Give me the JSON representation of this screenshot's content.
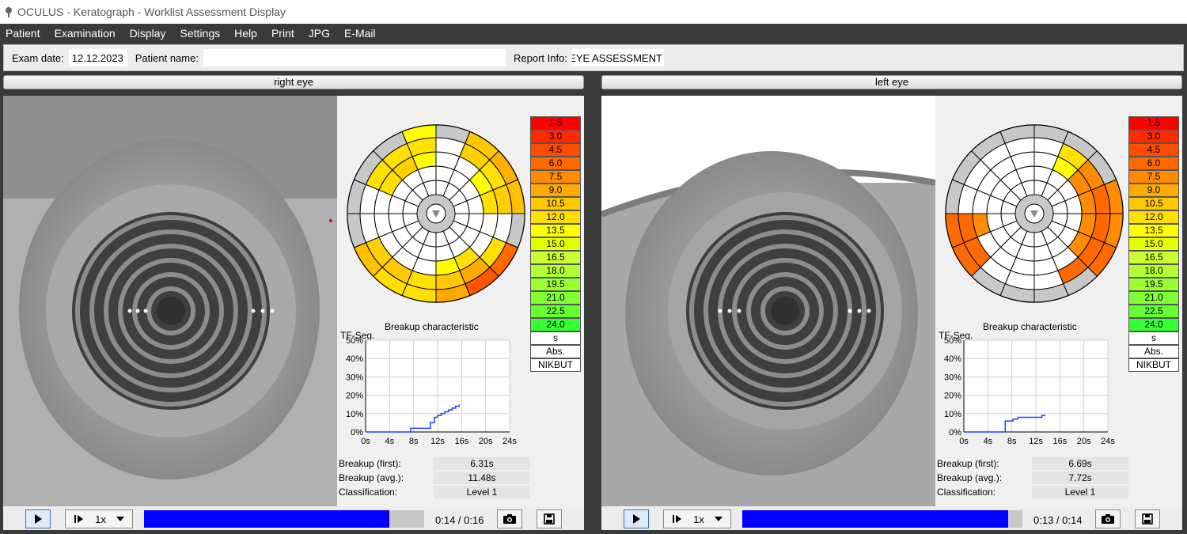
{
  "window": {
    "title": "OCULUS - Keratograph - Worklist Assessment Display"
  },
  "menu": [
    "Patient",
    "Examination",
    "Display",
    "Settings",
    "Help",
    "Print",
    "JPG",
    "E-Mail"
  ],
  "info": {
    "exam_date_label": "Exam date:",
    "exam_date": "12.12.2023",
    "patient_name_label": "Patient name:",
    "patient_name": "",
    "report_info_label": "Report Info:",
    "report_info": "RY EYE ASSESSMENT"
  },
  "scale": {
    "values": [
      "1.5",
      "3.0",
      "4.5",
      "6.0",
      "7.5",
      "9.0",
      "10.5",
      "12.0",
      "13.5",
      "15.0",
      "16.5",
      "18.0",
      "19.5",
      "21.0",
      "22.5",
      "24.0"
    ],
    "colors": [
      "#ff0000",
      "#ff2a00",
      "#ff4d00",
      "#ff6a00",
      "#ff8c00",
      "#ffaa00",
      "#ffc800",
      "#ffe000",
      "#ffff00",
      "#e6ff00",
      "#ccff33",
      "#b3ff33",
      "#99ff33",
      "#80ff33",
      "#66ff33",
      "#33ff33"
    ],
    "extra": [
      "s",
      "Abs.",
      "NIKBUT"
    ]
  },
  "icons": {
    "play": "play-icon",
    "step": "step-play-icon",
    "dropdown": "chevron-down-icon",
    "camera": "camera-icon",
    "save": "save-icon"
  },
  "chart_axes": {
    "title": "Breakup characteristic",
    "ylabel": "TF-Seg.",
    "yticks": [
      "50%",
      "40%",
      "30%",
      "20%",
      "10%",
      "0%"
    ],
    "xticks": [
      "0s",
      "4s",
      "8s",
      "12s",
      "16s",
      "20s",
      "24s"
    ]
  },
  "stat_labels": {
    "first": "Breakup (first):",
    "avg": "Breakup (avg.):",
    "classification": "Classification:"
  },
  "eyes": {
    "right": {
      "header": "right eye",
      "breakup_first": "6.31s",
      "breakup_avg": "11.48s",
      "classification": "Level 1",
      "time": "0:14 / 0:16",
      "speed": "1x",
      "progress": 0.875,
      "chart_data": {
        "type": "line",
        "title": "Breakup characteristic",
        "ylabel": "TF-Seg.",
        "xlim": [
          0,
          24
        ],
        "ylim": [
          0,
          50
        ],
        "x": [
          0,
          6.3,
          7.5,
          10.2,
          10.8,
          11.5,
          12.0,
          12.6,
          13.2,
          13.8,
          14.4,
          15.0,
          15.6
        ],
        "y": [
          0,
          0,
          2,
          2,
          5,
          8,
          9,
          10,
          11,
          12,
          13,
          14,
          15
        ]
      },
      "segments": [
        {
          "ring": 3,
          "sector": 13,
          "color": "#ffe000"
        },
        {
          "ring": 4,
          "sector": 13,
          "color": "#ffe000"
        },
        {
          "ring": 3,
          "sector": 14,
          "color": "#ffd000"
        },
        {
          "ring": 4,
          "sector": 14,
          "color": "#ffe000"
        },
        {
          "ring": 3,
          "sector": 15,
          "color": "#ffff00"
        },
        {
          "ring": 4,
          "sector": 15,
          "color": "#ffe000"
        },
        {
          "ring": 5,
          "sector": 15,
          "color": "#ffff00"
        },
        {
          "ring": 3,
          "sector": 16,
          "color": "#ffe000"
        },
        {
          "ring": 4,
          "sector": 16,
          "color": "#ffff00"
        },
        {
          "ring": 4,
          "sector": 1,
          "color": "#ffd000"
        },
        {
          "ring": 5,
          "sector": 1,
          "color": "#ffc800"
        },
        {
          "ring": 5,
          "sector": 2,
          "color": "#ffb000"
        },
        {
          "ring": 4,
          "sector": 2,
          "color": "#ffe000"
        },
        {
          "ring": 3,
          "sector": 2,
          "color": "#ffff00"
        },
        {
          "ring": 3,
          "sector": 3,
          "color": "#ffe000"
        },
        {
          "ring": 4,
          "sector": 3,
          "color": "#ffd000"
        },
        {
          "ring": 5,
          "sector": 3,
          "color": "#ffc000"
        },
        {
          "ring": 4,
          "sector": 5,
          "color": "#ffe000"
        },
        {
          "ring": 5,
          "sector": 5,
          "color": "#ff6a00"
        },
        {
          "ring": 5,
          "sector": 6,
          "color": "#ff5500"
        },
        {
          "ring": 4,
          "sector": 6,
          "color": "#ffaa00"
        },
        {
          "ring": 3,
          "sector": 6,
          "color": "#ffe000"
        },
        {
          "ring": 4,
          "sector": 7,
          "color": "#ffc800"
        },
        {
          "ring": 5,
          "sector": 7,
          "color": "#ffaa00"
        },
        {
          "ring": 3,
          "sector": 7,
          "color": "#ffff00"
        },
        {
          "ring": 4,
          "sector": 8,
          "color": "#ffe000"
        },
        {
          "ring": 5,
          "sector": 8,
          "color": "#ffe000"
        },
        {
          "ring": 4,
          "sector": 9,
          "color": "#ffc800"
        },
        {
          "ring": 5,
          "sector": 9,
          "color": "#ffe000"
        },
        {
          "ring": 5,
          "sector": 10,
          "color": "#ffc000"
        },
        {
          "ring": 4,
          "sector": 10,
          "color": "#ffd000"
        }
      ]
    },
    "left": {
      "header": "left eye",
      "breakup_first": "6.69s",
      "breakup_avg": "7.72s",
      "classification": "Level 1",
      "time": "0:13 / 0:14",
      "speed": "1x",
      "progress": 0.95,
      "chart_data": {
        "type": "line",
        "title": "Breakup characteristic",
        "ylabel": "TF-Seg.",
        "xlim": [
          0,
          24
        ],
        "ylim": [
          0,
          50
        ],
        "x": [
          0,
          6.7,
          6.9,
          7.7,
          8.2,
          9.0,
          10.0,
          11.0,
          12.0,
          13.0,
          13.6
        ],
        "y": [
          0,
          0,
          6,
          6,
          7,
          8,
          8,
          8,
          8,
          9,
          9
        ]
      },
      "segments": [
        {
          "ring": 3,
          "sector": 1,
          "color": "#ffff00"
        },
        {
          "ring": 4,
          "sector": 1,
          "color": "#ffe000"
        },
        {
          "ring": 4,
          "sector": 2,
          "color": "#ff8c00"
        },
        {
          "ring": 3,
          "sector": 2,
          "color": "#ff8c00"
        },
        {
          "ring": 4,
          "sector": 3,
          "color": "#ff6a00"
        },
        {
          "ring": 3,
          "sector": 3,
          "color": "#ff8c00"
        },
        {
          "ring": 5,
          "sector": 3,
          "color": "#ff8c00"
        },
        {
          "ring": 4,
          "sector": 4,
          "color": "#ff6a00"
        },
        {
          "ring": 3,
          "sector": 4,
          "color": "#ff8c00"
        },
        {
          "ring": 5,
          "sector": 4,
          "color": "#ff8c00"
        },
        {
          "ring": 4,
          "sector": 5,
          "color": "#ff6a00"
        },
        {
          "ring": 5,
          "sector": 5,
          "color": "#ff6a00"
        },
        {
          "ring": 3,
          "sector": 5,
          "color": "#ff8c00"
        },
        {
          "ring": 4,
          "sector": 6,
          "color": "#ff6a00"
        },
        {
          "ring": 5,
          "sector": 10,
          "color": "#ff6a00"
        },
        {
          "ring": 5,
          "sector": 11,
          "color": "#ff6a00"
        },
        {
          "ring": 4,
          "sector": 10,
          "color": "#ff6a00"
        },
        {
          "ring": 4,
          "sector": 11,
          "color": "#ff6a00"
        },
        {
          "ring": 3,
          "sector": 11,
          "color": "#ff8c00"
        }
      ]
    }
  }
}
